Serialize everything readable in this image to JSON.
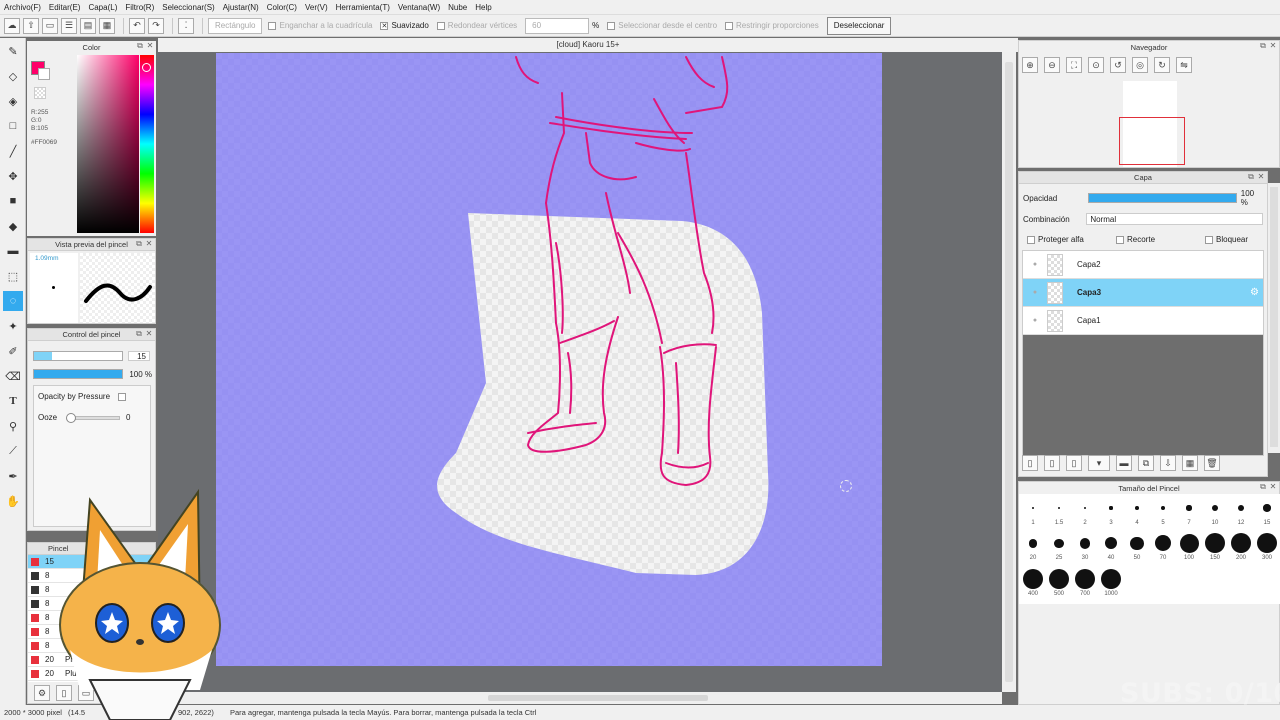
{
  "menu": [
    "Archivo(F)",
    "Editar(E)",
    "Capa(L)",
    "Filtro(R)",
    "Seleccionar(S)",
    "Ajustar(N)",
    "Color(C)",
    "Ver(V)",
    "Herramienta(T)",
    "Ventana(W)",
    "Nube",
    "Help"
  ],
  "toolbar": {
    "shape": "Rectángulo",
    "snap_label": "Enganchar a la cuadrícula",
    "smooth_label": "Suavizado",
    "round_label": "Redondear vértices",
    "round_value": "60",
    "percent": "%",
    "center_label": "Seleccionar desde el centro",
    "ratio_label": "Restringir proporciones",
    "deselect": "Deseleccionar"
  },
  "document": {
    "title": "[cloud] Kaoru 15+"
  },
  "color_panel": {
    "title": "Color",
    "r": "R:255",
    "g": "G:0",
    "b": "B:105",
    "hex": "#FF0069",
    "fg": "#ff0069"
  },
  "brush_preview": {
    "title": "Vista previa del pincel",
    "size": "1.09mm"
  },
  "brush_control": {
    "title": "Control del pincel",
    "size_value": "15",
    "size_fill": 0.2,
    "opacity_value": "100 %",
    "opacity_fill": 1.0,
    "pressure_label": "Opacity by Pressure",
    "ooze_label": "Ooze",
    "ooze_value": "0"
  },
  "brush_list": {
    "title": "Pincel",
    "items": [
      {
        "size": "15",
        "name": "",
        "color": "#e8303c",
        "sel": true
      },
      {
        "size": "8",
        "name": "",
        "color": "#333333"
      },
      {
        "size": "8",
        "name": "",
        "color": "#333333"
      },
      {
        "size": "8",
        "name": "",
        "color": "#333333"
      },
      {
        "size": "8",
        "name": "",
        "color": "#e8303c"
      },
      {
        "size": "8",
        "name": "",
        "color": "#e8303c"
      },
      {
        "size": "8",
        "name": "Pluma",
        "color": "#e8303c"
      },
      {
        "size": "20",
        "name": "Pluma estilo",
        "color": "#e8303c"
      },
      {
        "size": "20",
        "name": "Pluma est",
        "color": "#e8303c"
      }
    ]
  },
  "navigator": {
    "title": "Navegador"
  },
  "layer_panel": {
    "title": "Capa",
    "opacity_label": "Opacidad",
    "opacity_value": "100 %",
    "opacity_fill": 1.0,
    "blend_label": "Combinación",
    "blend_value": "Normal",
    "protect_alpha": "Proteger alfa",
    "clipping": "Recorte",
    "lock": "Bloquear",
    "layers": [
      {
        "name": "Capa2",
        "selected": false
      },
      {
        "name": "Capa3",
        "selected": true
      },
      {
        "name": "Capa1",
        "selected": false
      }
    ]
  },
  "brush_size_panel": {
    "title": "Tamaño del Pincel",
    "sizes": [
      "1",
      "1.5",
      "2",
      "3",
      "4",
      "5",
      "7",
      "10",
      "12",
      "15",
      "20",
      "25",
      "30",
      "40",
      "50",
      "70",
      "100",
      "150",
      "200",
      "300",
      "400",
      "500",
      "700",
      "1000"
    ]
  },
  "status": {
    "dims": "2000 * 3000 pixel",
    "coords": "(14.5",
    "coords2": "902, 2622)",
    "hint": "Para agregar, mantenga pulsada la tecla Mayús. Para borrar, mantenga pulsada la tecla Ctrl"
  },
  "overlay": {
    "subs": "SUBS: 0/10"
  }
}
